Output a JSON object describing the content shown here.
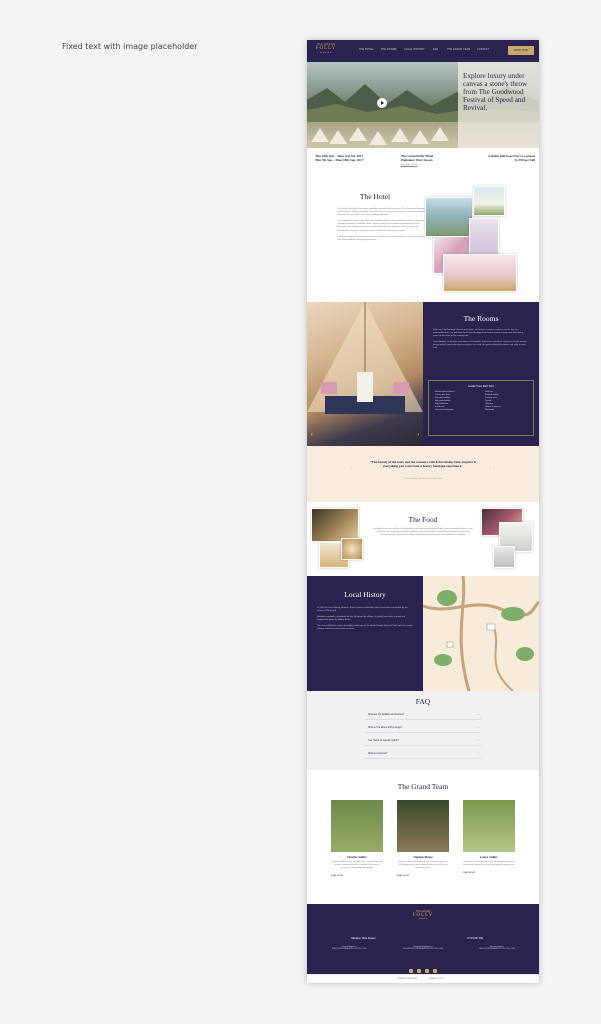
{
  "caption": "Fixed text with image placeholder",
  "brand": {
    "top": "THE GRAND",
    "name": "FOLLY",
    "bottom": "★★★★★"
  },
  "nav": {
    "items": [
      "THE HOTEL",
      "THE ROOMS",
      "LOCAL HISTORY",
      "FAQ",
      "THE GRAND TEAM",
      "CONTACT"
    ],
    "cta": "BOOK NOW"
  },
  "hero": {
    "title": "Explore luxury under canvas a stone's throw from The Goodwood Festival of Speed and Revival."
  },
  "info": {
    "dates": [
      "Thu 29th Jun – Mon 3rd Jul, 2017",
      "Thu 7th Sep – Mon 18th Sep, 2017"
    ],
    "venue": [
      "The Grand Folly Hotel",
      "Halnaker, West Sussex"
    ],
    "venue_link": "SEE MAP HERE",
    "offer": [
      "4 nights half board for two guests",
      "£1,399 per bell"
    ]
  },
  "hotel": {
    "title": "The Hotel",
    "paras": [
      "The Grand Folly Hotel has been specially created for those visiting The Goodwood Revival and Festival of Speed, providing the perfect base for guests who appreciate both luxury and convenience, just over a mile from Goodwood Estate.",
      "Local landowner and racing enthusiast Stephen Moore has joined forces with the boutique camping company Portobello Tents. Together they have created an experience which represents the Goodwood essence, having the attention of British classic racing with exceptional hospitality, all housed under canvas and beneath the stars.",
      "Traditional lodging, delicious meals sourced fresh, and events curated in a Glorious Grand Folly Hotel boutique camping experience."
    ]
  },
  "rooms": {
    "title": "The Rooms",
    "paras": [
      "While we hold heritage close to our hearts, we believe creature comforts are the key to a memorable stay. Our bell tents have been lovingly furnished to create a warm and welcoming space in the heart of the countryside.",
      "Laura Audley, co-founder and owner of Portobello Tents has a wealth of experience in the interior design world, hand-selecting every piece to create the perfect blend of comfort and style in each tent."
    ],
    "bell_title": "Inside Your Bell Tent",
    "bell_left": [
      "Hand-made mattress",
      "Luxury bed linen",
      "Scented candles",
      "Hot water bottles",
      "Wool blankets",
      "Full board",
      "Daily housekeeping"
    ],
    "bell_right": [
      "Lanterns",
      "Bedside tables",
      "Seating area",
      "Towels",
      "Toiletries",
      "Robes & slippers",
      "Wardrobe"
    ]
  },
  "quote": {
    "text": "\"The beauty of the tents and the romance which Portobello Tents inspires is everything you want from a luxury boutique experience\"",
    "attr": "— Laura Audley, Founder of Portobello Tents"
  },
  "food": {
    "title": "The Food",
    "para": "Included in the rate will be a full breakfast each morning with both English and continental options, plus a three course evening meal with a different menu each night. Food will be prepared by the local renowned chefs. The kitchen will be stocked through the week and a full bar is available."
  },
  "history": {
    "title": "Local History",
    "paras": [
      "In 1635 Sir John Morley, Baronet, built a house at Halnaker which was later remodelled by the Dukes of Richmond.",
      "Halnaker windmill, a landmark on the hill above the village, is visible from miles around and inspired the poem by Hilaire Belloc.",
      "The Grand Folly lies within the rolling landscape of the South Downs National Park, with the estate, villages and racecourse close at hand."
    ]
  },
  "faq": {
    "title": "FAQ",
    "items": [
      "What are the facilities and luxuries?",
      "What is The Grand Folly Lounge?",
      "Can I book for specific nights?",
      "What is a bell tent?"
    ]
  },
  "team": {
    "title": "The Grand Team",
    "members": [
      {
        "name": "Charles Audley",
        "bio": "Charles Audley is the founder of the Technology and design company based in London. He brings a passion for hospitality and design.",
        "link": "READ MORE"
      },
      {
        "name": "Stephen Moore",
        "bio": "Stephen owns the land and has a long history with the Goodwood events, having raced at the Revival for many years.",
        "link": "READ MORE"
      },
      {
        "name": "Laura Audley",
        "bio": "Laura has a background in interior design and works closely with guests to create memorable experiences.",
        "link": "READ MORE"
      }
    ]
  },
  "footer": {
    "address": "Halnaker, West Sussex",
    "phone": "07715 257 460",
    "contacts": [
      {
        "label": "General Enquiries",
        "value": "INFO@THEGRANDFOLLYHOTEL.COM"
      },
      {
        "label": "Bookings/Registrations",
        "value": "BOOKINGS@THEGRANDFOLLYHOTEL.COM"
      },
      {
        "label": "Accommodation",
        "value": "HELLO@THEGRANDFOLLYHOTEL.COM"
      }
    ],
    "bottom": [
      "TERMS & CONDITIONS",
      "PRIVACY POLICY"
    ]
  }
}
